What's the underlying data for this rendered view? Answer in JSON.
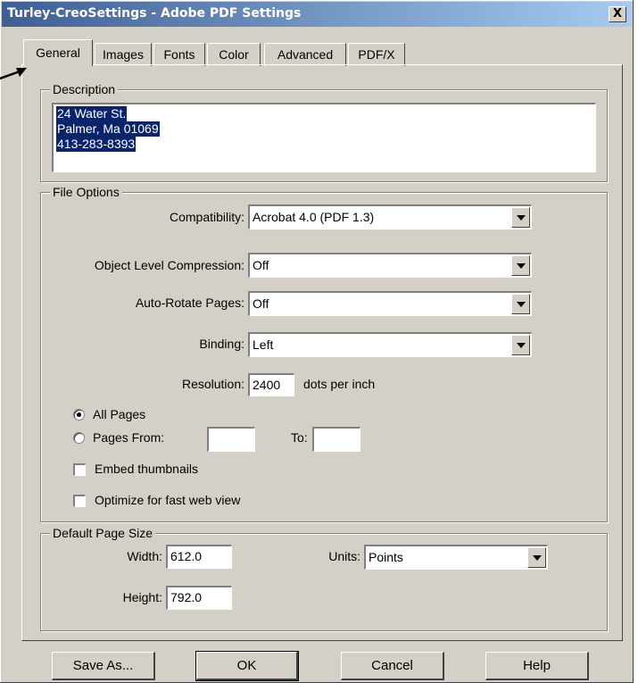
{
  "window": {
    "title": "Turley-CreoSettings - Adobe PDF Settings",
    "close_label": "X"
  },
  "tabs": [
    "General",
    "Images",
    "Fonts",
    "Color",
    "Advanced",
    "PDF/X"
  ],
  "active_tab": "General",
  "description": {
    "group_title": "Description",
    "lines": [
      "24 Water St.",
      "Palmer, Ma 01069",
      "413-283-8393"
    ]
  },
  "file_options": {
    "group_title": "File Options",
    "compatibility": {
      "label": "Compatibility:",
      "value": "Acrobat 4.0 (PDF 1.3)"
    },
    "object_compression": {
      "label": "Object Level Compression:",
      "value": "Off"
    },
    "auto_rotate": {
      "label": "Auto-Rotate Pages:",
      "value": "Off"
    },
    "binding": {
      "label": "Binding:",
      "value": "Left"
    },
    "resolution": {
      "label": "Resolution:",
      "value": "2400",
      "unit": "dots per inch"
    },
    "all_pages": {
      "label": "All Pages",
      "checked": true
    },
    "pages_from": {
      "label": "Pages From:",
      "from_value": "",
      "to_label": "To:",
      "to_value": "",
      "checked": false
    },
    "embed_thumbnails": {
      "label": "Embed thumbnails",
      "checked": false
    },
    "optimize_web": {
      "label": "Optimize for fast web view",
      "checked": false
    }
  },
  "page_size": {
    "group_title": "Default Page Size",
    "width": {
      "label": "Width:",
      "value": "612.0"
    },
    "height": {
      "label": "Height:",
      "value": "792.0"
    },
    "units": {
      "label": "Units:",
      "value": "Points"
    }
  },
  "buttons": {
    "save_as": "Save As...",
    "ok": "OK",
    "cancel": "Cancel",
    "help": "Help"
  },
  "colors": {
    "titlebar_start": "#3f5f93",
    "titlebar_end": "#a6caf0",
    "selection": "#0a246a",
    "dialog_bg": "#d4d0c8"
  }
}
